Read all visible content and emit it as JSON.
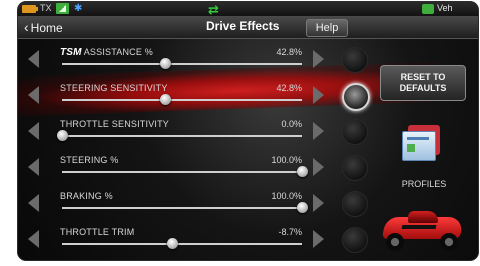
{
  "status_bar": {
    "tx_label": "TX",
    "vehicle_label": "Veh",
    "icons": [
      "battery-icon",
      "signal-icon",
      "bluetooth-icon",
      "link-arrows-icon",
      "vehicle-icon"
    ]
  },
  "nav": {
    "back_label": "Home",
    "title": "Drive Effects",
    "help_label": "Help"
  },
  "rows": [
    {
      "brand": "TSM",
      "label": "ASSISTANCE %",
      "value": "42.8%",
      "level_percent": 42.8
    },
    {
      "brand": "",
      "label": "STEERING SENSITIVITY",
      "value": "42.8%",
      "level_percent": 42.8
    },
    {
      "brand": "",
      "label": "THROTTLE SENSITIVITY",
      "value": "0.0%",
      "level_percent": 0.0
    },
    {
      "brand": "",
      "label": "STEERING %",
      "value": "100.0%",
      "level_percent": 100.0
    },
    {
      "brand": "",
      "label": "BRAKING %",
      "value": "100.0%",
      "level_percent": 100.0
    },
    {
      "brand": "",
      "label": "THROTTLE TRIM",
      "value": "-8.7%",
      "level_percent": 45.65
    }
  ],
  "selected_row_index": 1,
  "sidebar": {
    "reset_line1": "RESET TO",
    "reset_line2": "DEFAULTS",
    "profiles_label": "PROFILES"
  },
  "colors": {
    "highlight_red": "#d61e1e",
    "signal_green": "#3fae3c",
    "battery_orange": "#e0951f",
    "bluetooth_blue": "#4ea3ff"
  }
}
